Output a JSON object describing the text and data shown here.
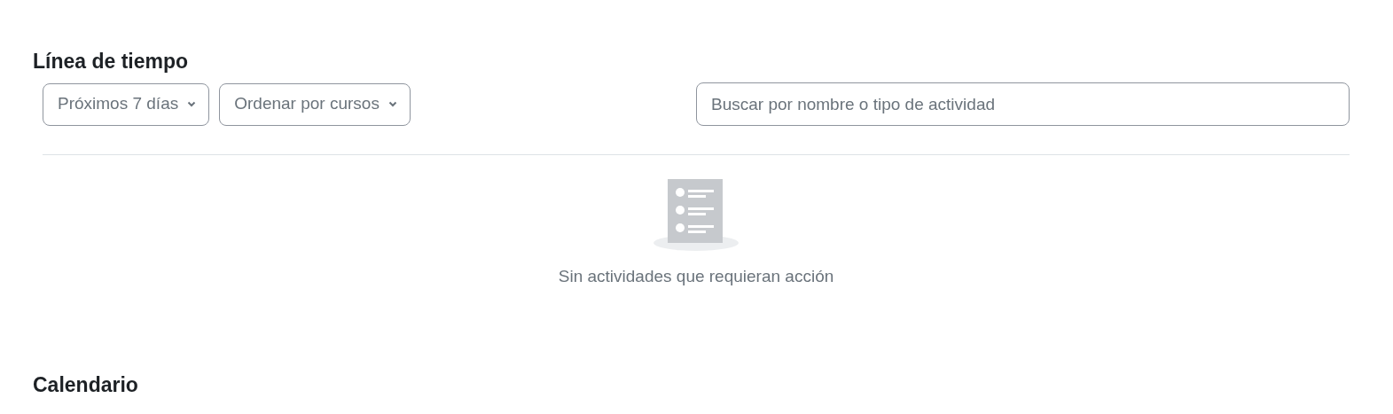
{
  "timeline": {
    "title": "Línea de tiempo",
    "filters": [
      "Próximos 7 días",
      "Ordenar por cursos"
    ],
    "search": {
      "placeholder": "Buscar por nombre o tipo de actividad"
    },
    "empty_message": "Sin actividades que requieran acción"
  },
  "calendar": {
    "title": "Calendario"
  }
}
